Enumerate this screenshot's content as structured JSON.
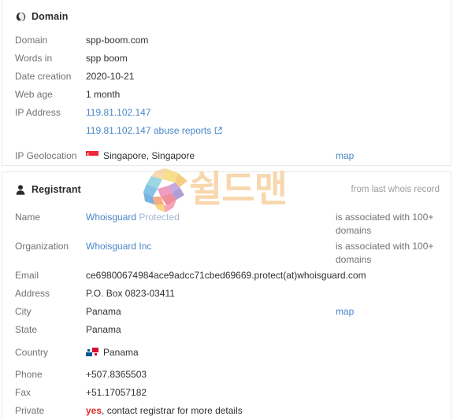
{
  "domain_card": {
    "icon": "globe-icon",
    "title": "Domain",
    "rows": [
      {
        "label": "Domain",
        "value": "spp-boom.com"
      },
      {
        "label": "Words in",
        "value": "spp boom"
      },
      {
        "label": "Date creation",
        "value": "2020-10-21"
      },
      {
        "label": "Web age",
        "value": "1 month"
      },
      {
        "label": "IP Address",
        "value": "119.81.102.147"
      },
      {
        "label": "",
        "value": "119.81.102.147 abuse reports"
      },
      {
        "label": "IP Geolocation",
        "value": "Singapore, Singapore",
        "aside": "map"
      }
    ]
  },
  "registrant_card": {
    "icon": "user-icon",
    "title": "Registrant",
    "from_whois": "from last whois record",
    "rows": [
      {
        "label": "Name",
        "value": "Whoisguard",
        "value2": "Protected",
        "aside": "is associated with 100+ domains"
      },
      {
        "label": "Organization",
        "value": "Whoisguard Inc",
        "aside": "is associated with 100+ domains"
      },
      {
        "label": "Email",
        "value": "ce69800674984ace9adcc71cbed69669.protect(at)whoisguard.com"
      },
      {
        "label": "Address",
        "value": "P.O. Box 0823-03411"
      },
      {
        "label": "City",
        "value": "Panama",
        "aside": "map"
      },
      {
        "label": "State",
        "value": "Panama"
      },
      {
        "label": "Country",
        "value": "Panama"
      },
      {
        "label": "Phone",
        "value": "+507.8365503"
      },
      {
        "label": "Fax",
        "value": "+51.17057182"
      },
      {
        "label": "Private",
        "value_highlight": "yes",
        "value": ", contact registrar for more details"
      }
    ]
  },
  "watermark": {
    "text": "쉴드맨",
    "logo": "shieldman-s-logo"
  },
  "colors": {
    "link": "#4a86c8",
    "label": "#6f7276",
    "value": "#2f3133",
    "alert": "#e02b2b",
    "muted": "#9b9ea2",
    "border": "#e7e9ec"
  }
}
